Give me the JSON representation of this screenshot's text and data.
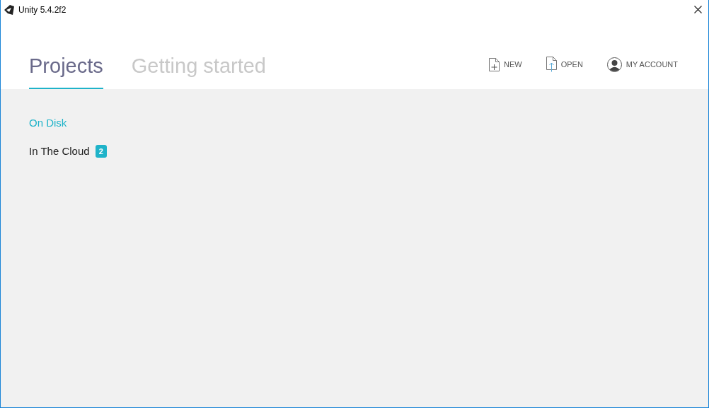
{
  "window": {
    "title": "Unity 5.4.2f2"
  },
  "tabs": [
    {
      "label": "Projects",
      "selected": true
    },
    {
      "label": "Getting started",
      "selected": false
    }
  ],
  "actions": [
    {
      "kind": "new",
      "label": "NEW"
    },
    {
      "kind": "open",
      "label": "OPEN"
    },
    {
      "kind": "account",
      "label": "MY ACCOUNT"
    }
  ],
  "sidebar": {
    "items": [
      {
        "label": "On Disk",
        "selected": true
      },
      {
        "label": "In The Cloud",
        "selected": false,
        "badge": "2"
      }
    ]
  }
}
